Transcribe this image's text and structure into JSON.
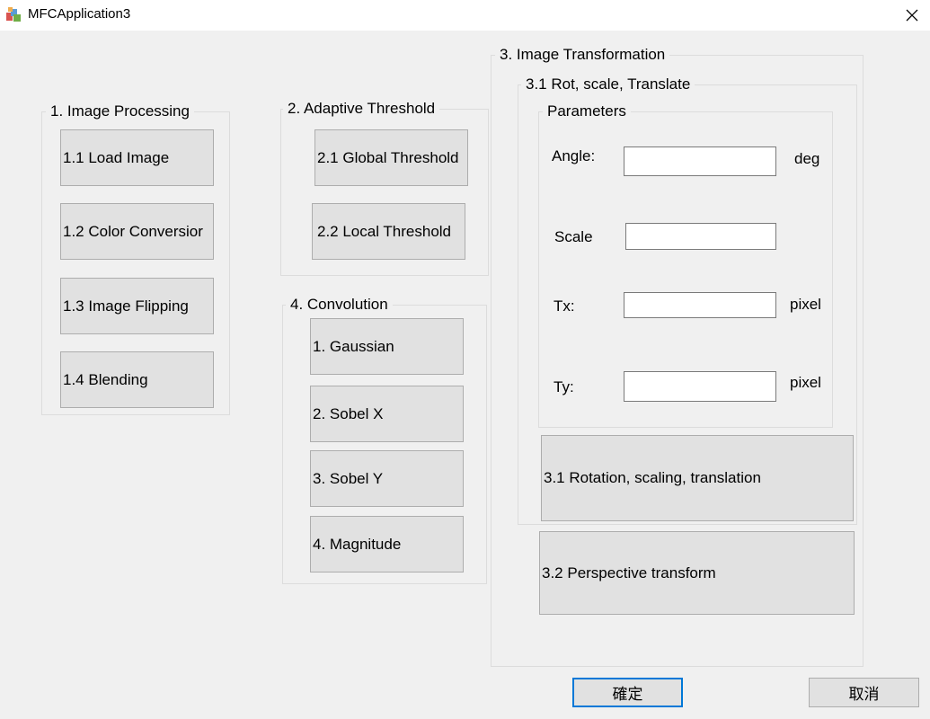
{
  "window": {
    "title": "MFCApplication3"
  },
  "image_processing": {
    "title": "1. Image Processing",
    "load": "1.1 Load Image",
    "color": "1.2 Color Conversior",
    "flip": "1.3 Image Flipping",
    "blend": "1.4 Blending"
  },
  "adaptive": {
    "title": "2. Adaptive  Threshold",
    "global": "2.1 Global Threshold",
    "local": "2.2 Local Threshold"
  },
  "convolution": {
    "title": "4. Convolution",
    "gaussian": "1. Gaussian",
    "sobelx": "2. Sobel X",
    "sobely": "3. Sobel Y",
    "magnitude": "4. Magnitude"
  },
  "transform": {
    "title": "3. Image Transformation",
    "rst_title": "3.1 Rot, scale, Translate",
    "params_title": "Parameters",
    "angle_label": "Angle:",
    "angle_unit": "deg",
    "scale_label": "Scale",
    "tx_label": "Tx:",
    "tx_unit": "pixel",
    "ty_label": "Ty:",
    "ty_unit": "pixel",
    "angle_value": "",
    "scale_value": "",
    "tx_value": "",
    "ty_value": "",
    "rst_button": "3.1 Rotation, scaling, translation",
    "perspective_button": "3.2 Perspective transform"
  },
  "dialog": {
    "ok": "確定",
    "cancel": "取消"
  }
}
